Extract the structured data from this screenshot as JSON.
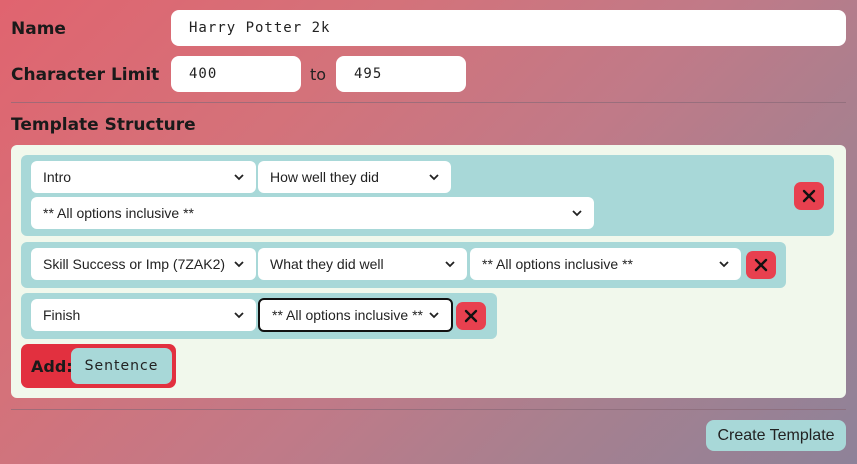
{
  "form": {
    "name_label": "Name",
    "name_value": "Harry Potter 2k",
    "char_limit_label": "Character Limit",
    "char_min": "400",
    "to_label": "to",
    "char_max": "495",
    "template_structure_label": "Template Structure"
  },
  "rows": [
    {
      "selects": [
        "Intro",
        "How well they did",
        "** All options inclusive **"
      ]
    },
    {
      "selects": [
        "Skill Success or Imp (7ZAK2)",
        "What they did well",
        "** All options inclusive **"
      ]
    },
    {
      "selects": [
        "Finish",
        "** All options inclusive **"
      ]
    }
  ],
  "add": {
    "label": "Add:",
    "sentence_button": "Sentence"
  },
  "create_button": "Create Template",
  "colors": {
    "panel": "#f1f8ec",
    "row": "#a8d8d8",
    "remove": "#e8404f",
    "add_box": "#e2303f"
  },
  "icons": {
    "remove": "close-x-icon",
    "dropdown": "chevron-down-icon"
  }
}
